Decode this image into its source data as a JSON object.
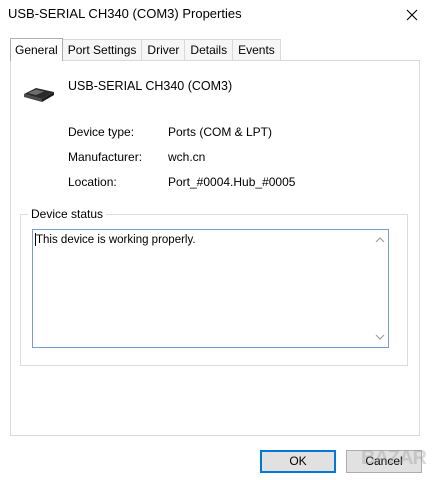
{
  "window": {
    "title": "USB-SERIAL CH340 (COM3) Properties"
  },
  "tabs": [
    {
      "label": "General",
      "active": true
    },
    {
      "label": "Port Settings",
      "active": false
    },
    {
      "label": "Driver",
      "active": false
    },
    {
      "label": "Details",
      "active": false
    },
    {
      "label": "Events",
      "active": false
    }
  ],
  "device": {
    "icon": "usb-serial-device-icon",
    "name": "USB-SERIAL CH340 (COM3)"
  },
  "properties": [
    {
      "label": "Device type:",
      "value": "Ports (COM & LPT)"
    },
    {
      "label": "Manufacturer:",
      "value": "wch.cn"
    },
    {
      "label": "Location:",
      "value": "Port_#0004.Hub_#0005"
    }
  ],
  "status": {
    "legend": "Device status",
    "text": "This device is working properly."
  },
  "buttons": {
    "ok": "OK",
    "cancel": "Cancel"
  },
  "watermark": "BAZAR",
  "colors": {
    "focus_border": "#0078d7",
    "button_face": "#e1e1e1"
  }
}
